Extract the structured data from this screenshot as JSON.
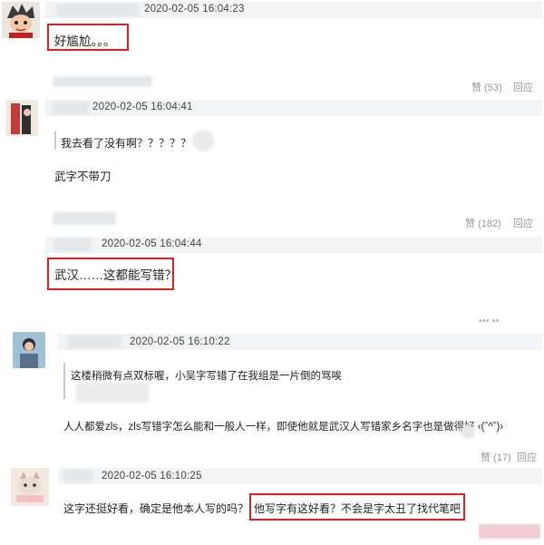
{
  "comments": [
    {
      "timestamp": "2020-02-05 16:04:23",
      "body": "好尴尬。。。",
      "actions": {
        "like": "赞 (53)",
        "reply": "回应"
      }
    },
    {
      "timestamp": "2020-02-05 16:04:41",
      "quoted": "我去看了没有啊？？？？？",
      "body": "武字不带刀",
      "actions": {
        "like": "赞 (182)",
        "reply": "回应"
      }
    },
    {
      "timestamp": "2020-02-05 16:04:44",
      "body": "武汉……这都能写错？"
    },
    {
      "timestamp": "2020-02-05 16:10:22",
      "quoted": "这楼稍微有点双标喔，小吴字写错了在我组是一片倒的骂唉",
      "body": "人人都爱zls，zls写错字怎么能和一般人一样，即使他就是武汉人写错家乡名字也是做得好 ‹(ˆ^ˆ)›",
      "actions": {
        "like": "赞 (17)",
        "reply": "回应"
      }
    },
    {
      "timestamp": "2020-02-05 16:10:25",
      "body_part1": "这字还挺好看，确定是他本人写的吗？",
      "body_part2": "他写字有这好看？不会是字太丑了找代笔吧"
    }
  ],
  "colors": {
    "highlight_box": "#e02020",
    "header_bar": "#f1f3f4",
    "meta_text": "#999999"
  },
  "icons": [
    "user-avatar",
    "quote-mark"
  ]
}
